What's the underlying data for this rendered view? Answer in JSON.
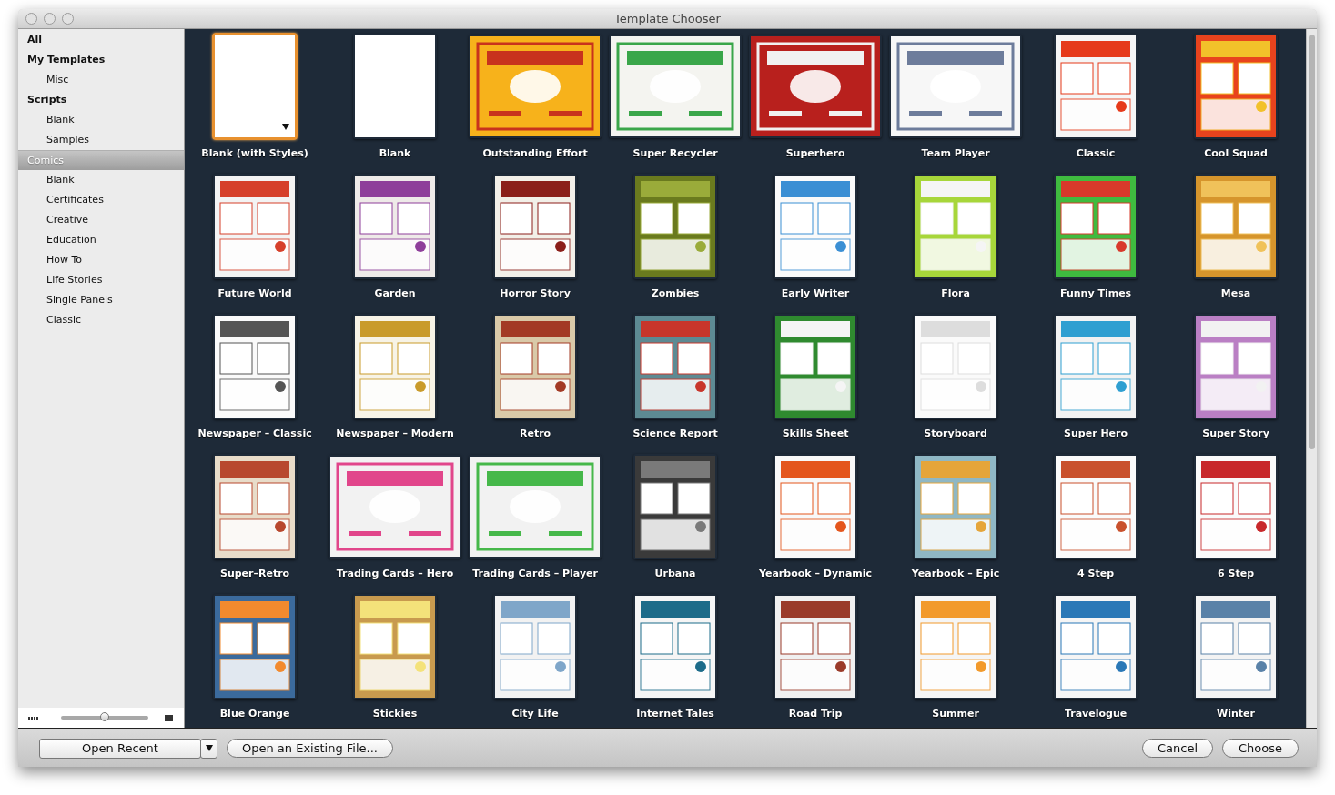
{
  "window": {
    "title": "Template Chooser"
  },
  "sidebar": {
    "items": [
      {
        "label": "All",
        "selected": false
      },
      {
        "label": "My Templates",
        "selected": false,
        "children": [
          {
            "label": "Misc",
            "selected": false
          }
        ]
      },
      {
        "label": "Scripts",
        "selected": false,
        "children": [
          {
            "label": "Blank",
            "selected": false
          },
          {
            "label": "Samples",
            "selected": false
          }
        ]
      },
      {
        "label": "Comics",
        "selected": true,
        "children": [
          {
            "label": "Blank",
            "selected": false
          },
          {
            "label": "Certificates",
            "selected": false
          },
          {
            "label": "Creative",
            "selected": false
          },
          {
            "label": "Education",
            "selected": false
          },
          {
            "label": "How To",
            "selected": false
          },
          {
            "label": "Life Stories",
            "selected": false
          },
          {
            "label": "Single Panels",
            "selected": false
          },
          {
            "label": "Classic",
            "selected": false
          }
        ]
      }
    ],
    "zoom_slider": {
      "level": 0.5
    }
  },
  "templates": [
    {
      "label": "Blank (with Styles)",
      "kind": "blank",
      "selected": true,
      "has_menu": true
    },
    {
      "label": "Blank",
      "kind": "blank",
      "selected": false
    },
    {
      "label": "Outstanding Effort",
      "kind": "landscape",
      "selected": false
    },
    {
      "label": "Super Recycler",
      "kind": "landscape",
      "selected": false
    },
    {
      "label": "Superhero",
      "kind": "landscape",
      "selected": false
    },
    {
      "label": "Team Player",
      "kind": "landscape",
      "selected": false
    },
    {
      "label": "Classic",
      "kind": "portrait",
      "selected": false
    },
    {
      "label": "Cool Squad",
      "kind": "portrait",
      "selected": false
    },
    {
      "label": "Future World",
      "kind": "portrait",
      "selected": false
    },
    {
      "label": "Garden",
      "kind": "portrait",
      "selected": false
    },
    {
      "label": "Horror Story",
      "kind": "portrait",
      "selected": false
    },
    {
      "label": "Zombies",
      "kind": "portrait",
      "selected": false
    },
    {
      "label": "Early Writer",
      "kind": "portrait",
      "selected": false
    },
    {
      "label": "Flora",
      "kind": "portrait",
      "selected": false
    },
    {
      "label": "Funny Times",
      "kind": "portrait",
      "selected": false
    },
    {
      "label": "Mesa",
      "kind": "portrait",
      "selected": false
    },
    {
      "label": "Newspaper – Classic",
      "kind": "portrait",
      "selected": false
    },
    {
      "label": "Newspaper – Modern",
      "kind": "portrait",
      "selected": false
    },
    {
      "label": "Retro",
      "kind": "portrait",
      "selected": false
    },
    {
      "label": "Science Report",
      "kind": "portrait",
      "selected": false
    },
    {
      "label": "Skills Sheet",
      "kind": "portrait",
      "selected": false
    },
    {
      "label": "Storyboard",
      "kind": "portrait",
      "selected": false
    },
    {
      "label": "Super Hero",
      "kind": "portrait",
      "selected": false
    },
    {
      "label": "Super Story",
      "kind": "portrait",
      "selected": false
    },
    {
      "label": "Super–Retro",
      "kind": "portrait",
      "selected": false
    },
    {
      "label": "Trading Cards – Hero",
      "kind": "landscape",
      "selected": false
    },
    {
      "label": "Trading Cards – Player",
      "kind": "landscape",
      "selected": false
    },
    {
      "label": "Urbana",
      "kind": "portrait",
      "selected": false
    },
    {
      "label": "Yearbook – Dynamic",
      "kind": "portrait",
      "selected": false
    },
    {
      "label": "Yearbook – Epic",
      "kind": "portrait",
      "selected": false
    },
    {
      "label": "4 Step",
      "kind": "portrait",
      "selected": false
    },
    {
      "label": "6 Step",
      "kind": "portrait",
      "selected": false
    },
    {
      "label": "Blue Orange",
      "kind": "portrait",
      "selected": false
    },
    {
      "label": "Stickies",
      "kind": "portrait",
      "selected": false
    },
    {
      "label": "City Life",
      "kind": "portrait",
      "selected": false
    },
    {
      "label": "Internet Tales",
      "kind": "portrait",
      "selected": false
    },
    {
      "label": "Road Trip",
      "kind": "portrait",
      "selected": false
    },
    {
      "label": "Summer",
      "kind": "portrait",
      "selected": false
    },
    {
      "label": "Travelogue",
      "kind": "portrait",
      "selected": false
    },
    {
      "label": "Winter",
      "kind": "portrait",
      "selected": false
    }
  ],
  "buttons": {
    "open_recent": "Open Recent",
    "open_existing": "Open an Existing File...",
    "cancel": "Cancel",
    "choose": "Choose"
  }
}
